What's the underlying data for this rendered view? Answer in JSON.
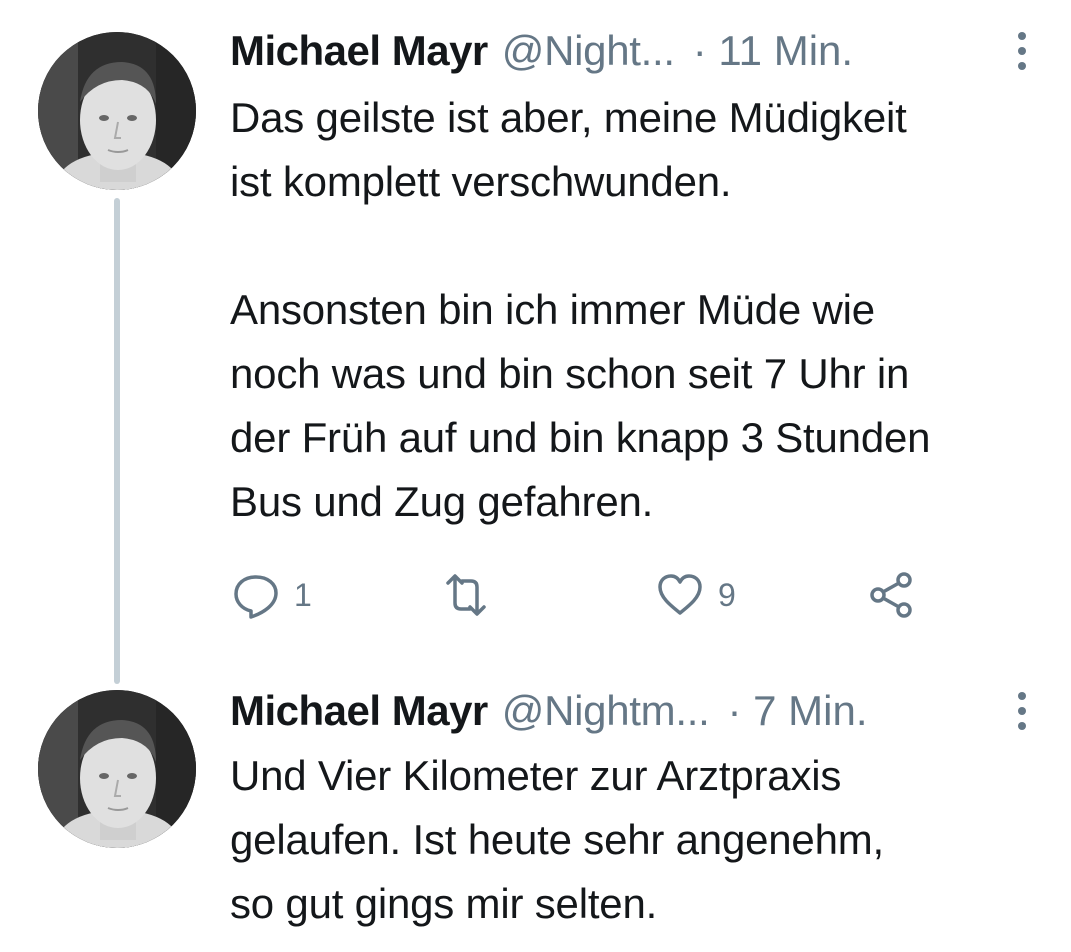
{
  "tweets": [
    {
      "name": "Michael Mayr",
      "handle": "@Night...",
      "time": "· 11 Min.",
      "text": "Das geilste ist aber, meine Müdigkeit\nist komplett verschwunden.\n\nAnsonsten bin ich immer Müde wie\nnoch was und bin schon seit 7 Uhr in\nder Früh auf und bin knapp 3 Stunden\nBus und Zug gefahren.",
      "reply_count": "1",
      "retweet_count": "",
      "like_count": "9"
    },
    {
      "name": "Michael Mayr",
      "handle": "@Nightm...",
      "time": "· 7 Min.",
      "text": "Und Vier Kilometer zur Arztpraxis\ngelaufen. Ist heute sehr angenehm,\nso gut gings mir selten."
    }
  ],
  "colors": {
    "text": "#14171a",
    "secondary": "#657786",
    "thread_line": "#c4cfd6",
    "background": "#ffffff"
  },
  "icons": [
    "avatar",
    "more-icon",
    "reply-icon",
    "retweet-icon",
    "like-icon",
    "share-icon"
  ]
}
